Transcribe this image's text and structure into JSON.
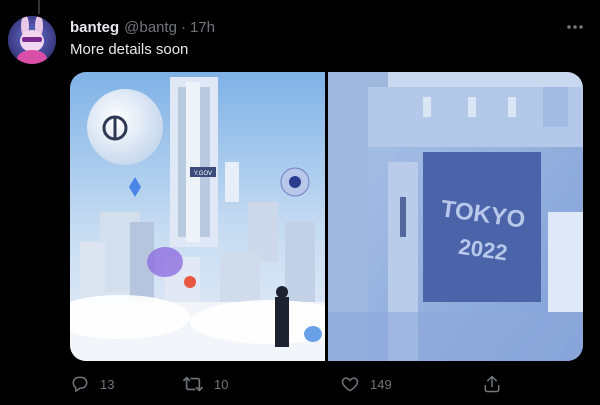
{
  "tweet": {
    "display_name": "banteg",
    "handle": "@bantg",
    "separator": "·",
    "time": "17h",
    "text": "More details soon"
  },
  "media": {
    "left_image": {
      "signs": [
        "Y.GOV"
      ],
      "description_icons": [
        "yearn-logo",
        "ethereum-logo",
        "curve-logo",
        "sushi-mascot"
      ]
    },
    "right_image": {
      "sign_line1": "TOKYO",
      "sign_line2": "2022"
    }
  },
  "actions": {
    "reply_count": "13",
    "retweet_count": "10",
    "like_count": "149"
  },
  "icons": {
    "reply": "reply-icon",
    "retweet": "retweet-icon",
    "like": "heart-icon",
    "share": "share-icon",
    "more": "more-icon"
  },
  "colors": {
    "background": "#000000",
    "text_primary": "#e7e9ea",
    "text_secondary": "#71767b"
  }
}
